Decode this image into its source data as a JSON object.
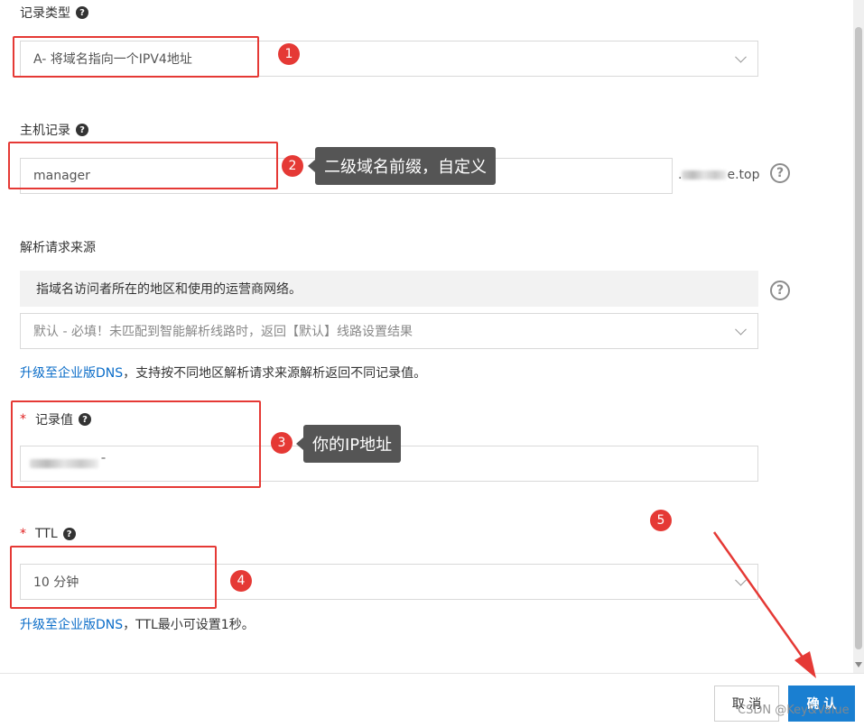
{
  "record_type": {
    "label": "记录类型",
    "value": "A- 将域名指向一个IPV4地址"
  },
  "host_record": {
    "label": "主机记录",
    "value": "manager",
    "suffix_start": ".",
    "suffix_end": "e.top"
  },
  "source": {
    "label": "解析请求来源",
    "info": "指域名访问者所在的地区和使用的运营商网络。",
    "select_value": "默认 - 必填！未匹配到智能解析线路时，返回【默认】线路设置结果",
    "upgrade_link": "升级至企业版DNS",
    "upgrade_note": "，支持按不同地区解析请求来源解析返回不同记录值。"
  },
  "record_value": {
    "label": "记录值",
    "required": "*",
    "value_tail": "¯"
  },
  "ttl": {
    "label": "TTL",
    "required": "*",
    "value": "10 分钟",
    "upgrade_link": "升级至企业版DNS",
    "upgrade_note": "，TTL最小可设置1秒。"
  },
  "annotations": {
    "badge_1": "1",
    "badge_2": "2",
    "badge_3": "3",
    "badge_4": "4",
    "badge_5": "5",
    "tooltip_2": "二级域名前缀，自定义",
    "tooltip_3": "你的IP地址",
    "color": "#e53935"
  },
  "icons": {
    "help_small": "?",
    "help_circle": "?"
  },
  "footer": {
    "cancel": "取 消",
    "confirm": "确 认"
  },
  "watermark": "CSDN @Key&Value",
  "colors": {
    "primary": "#1a7fd1",
    "link": "#0a6cc8",
    "annotation": "#e53935"
  }
}
